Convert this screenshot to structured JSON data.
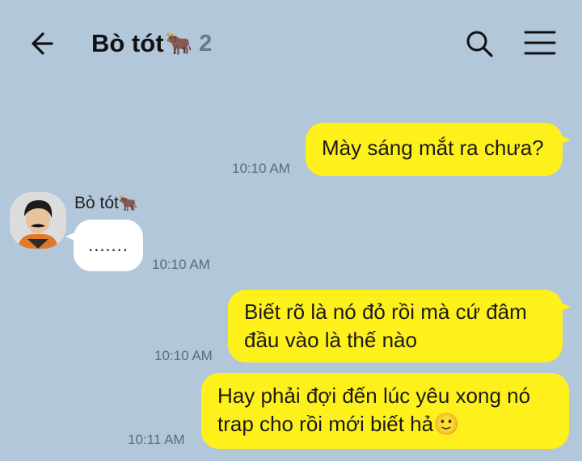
{
  "header": {
    "title": "Bò tót",
    "title_emoji": "🐂",
    "member_count": "2",
    "icons": {
      "back": "back-arrow-icon",
      "search": "search-icon",
      "menu": "hamburger-menu-icon"
    }
  },
  "colors": {
    "background": "#b2c7da",
    "my_bubble": "#fef01b",
    "their_bubble": "#ffffff",
    "timestamp": "#5e6a75",
    "member_count": "#6e7884"
  },
  "messages": [
    {
      "sender": "me",
      "text": "Mày sáng mắt ra chưa?",
      "time": "10:10 AM"
    },
    {
      "sender": "other",
      "sender_name": "Bò tót",
      "sender_emoji": "🐂",
      "text": ".......",
      "time": "10:10 AM"
    },
    {
      "sender": "me",
      "lines": [
        "Biết rõ là nó đỏ rồi mà cứ đâm",
        "đầu vào là thế nào"
      ],
      "time": "10:10 AM"
    },
    {
      "sender": "me",
      "lines": [
        "Hay phải đợi đến lúc yêu xong nó",
        "trap cho rồi mới biết hả"
      ],
      "emoji": "🙂",
      "time": "10:11 AM"
    }
  ]
}
